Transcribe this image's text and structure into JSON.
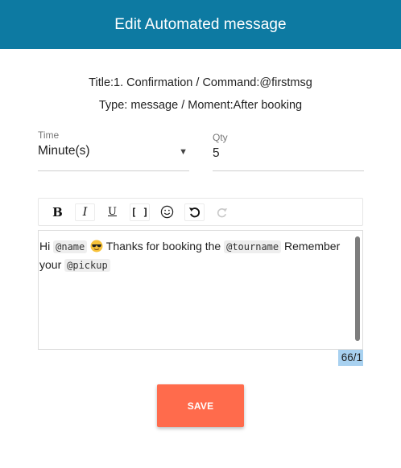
{
  "header": {
    "title": "Edit Automated message",
    "bg_color": "#0d7aa2"
  },
  "info": {
    "line1": "Title:1. Confirmation / Command:@firstmsg",
    "line2": "Type: message / Moment:After booking"
  },
  "time": {
    "label": "Time",
    "value": "Minute(s)",
    "caret": "▼"
  },
  "qty": {
    "label": "Qty",
    "value": "5"
  },
  "toolbar": {
    "bold": "B",
    "italic": "I",
    "underline": "U",
    "code": "[ ]",
    "icons": [
      "emoji-icon",
      "undo-icon",
      "redo-icon"
    ]
  },
  "editor": {
    "text_hi": "Hi",
    "var_name": "@name",
    "text_thanks": "Thanks for booking the",
    "var_tourname": "@tourname",
    "text_remember": "Remember your",
    "var_pickup": "@pickup"
  },
  "counter": "66/1",
  "save": {
    "label": "SAVE",
    "color": "#ff6b4c"
  }
}
